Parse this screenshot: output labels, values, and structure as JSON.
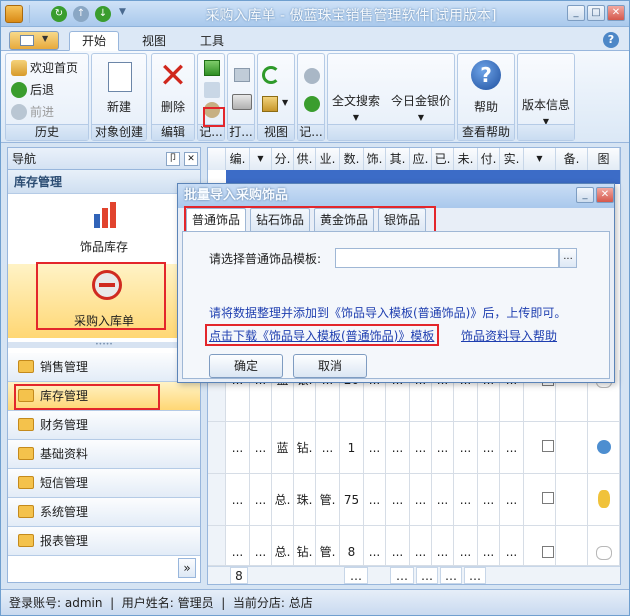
{
  "window": {
    "title": "采购入库单 - 傲蓝珠宝销售管理软件[试用版本]"
  },
  "ribbon_tabs": [
    "开始",
    "视图",
    "工具"
  ],
  "ribbon": {
    "history": {
      "label": "历史",
      "items": [
        "欢迎首页",
        "后退",
        "前进"
      ]
    },
    "create": {
      "label": "对象创建",
      "new": "新建"
    },
    "edit": {
      "label": "编辑",
      "delete": "删除"
    },
    "record": {
      "label": "记..."
    },
    "print": {
      "label": "打..."
    },
    "view": {
      "label": "视图"
    },
    "record2": {
      "label": "记..."
    },
    "search": {
      "label": "全文搜索"
    },
    "gold": {
      "label": "今日金银价"
    },
    "help": {
      "label": "帮助",
      "group": "查看帮助"
    },
    "version": {
      "label": "版本信息"
    }
  },
  "nav": {
    "title": "导航",
    "section": "库存管理",
    "tiles": [
      "饰品库存",
      "采购入库单"
    ],
    "items": [
      "销售管理",
      "库存管理",
      "财务管理",
      "基础资料",
      "短信管理",
      "系统管理",
      "报表管理"
    ],
    "more": "»"
  },
  "grid": {
    "headers": [
      "编.",
      "",
      "分.",
      "供.",
      "业.",
      "数.",
      "饰.",
      "其.",
      "应.",
      "已.",
      "未.",
      "付.",
      "实.",
      "",
      "备.",
      "图"
    ],
    "rows": [
      [
        "...",
        "...",
        "蓝",
        "银.",
        "...",
        "20",
        "...",
        "...",
        "...",
        "...",
        "...",
        "...",
        "..."
      ],
      [
        "...",
        "...",
        "蓝",
        "钻.",
        "...",
        "1",
        "...",
        "...",
        "...",
        "...",
        "...",
        "...",
        "..."
      ],
      [
        "...",
        "...",
        "总.",
        "珠.",
        "管.",
        "75",
        "...",
        "...",
        "...",
        "...",
        "...",
        "...",
        "..."
      ],
      [
        "...",
        "...",
        "总.",
        "钻.",
        "管.",
        "8",
        "...",
        "...",
        "...",
        "...",
        "...",
        "...",
        "..."
      ]
    ],
    "footer": [
      "8",
      "…",
      "…",
      "…",
      "…",
      "…"
    ]
  },
  "dialog": {
    "title": "批量导入采购饰品",
    "tabs": [
      "普通饰品",
      "钻石饰品",
      "黄金饰品",
      "银饰品"
    ],
    "template_label": "请选择普通饰品模板:",
    "template_value": "",
    "browse": "...",
    "instruction": "请将数据整理并添加到《饰品导入模板(普通饰品)》后，上传即可。",
    "download_link": "点击下载《饰品导入模板(普通饰品)》模板",
    "help_link": "饰品资料导入帮助",
    "ok": "确定",
    "cancel": "取消"
  },
  "status": {
    "text": "登录账号: admin  |  用户姓名: 管理员  |  当前分店: 总店"
  }
}
